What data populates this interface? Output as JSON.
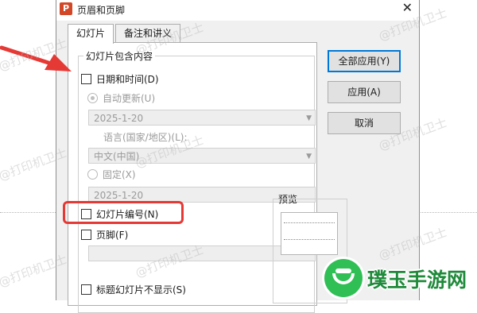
{
  "dialog": {
    "app_icon_letter": "P",
    "title": "页眉和页脚",
    "close_glyph": "✕",
    "tabs": [
      {
        "label": "幻灯片",
        "active": true
      },
      {
        "label": "备注和讲义",
        "active": false
      }
    ]
  },
  "slide_tab": {
    "group_title": "幻灯片包含内容",
    "date_time": {
      "label": "日期和时间(D)",
      "checked": false
    },
    "auto_update": {
      "label": "自动更新(U)",
      "selected": true,
      "enabled": false,
      "date_value": "2025-1-20"
    },
    "language": {
      "label": "语言(国家/地区)(L):",
      "value": "中文(中国)"
    },
    "fixed": {
      "label": "固定(X)",
      "selected": false,
      "enabled": false,
      "value": "2025-1-20"
    },
    "slide_number": {
      "label": "幻灯片编号(N)",
      "checked": false
    },
    "footer": {
      "label": "页脚(F)",
      "checked": false,
      "value": ""
    },
    "hide_on_title": {
      "label": "标题幻灯片不显示(S)",
      "checked": false
    }
  },
  "buttons": {
    "apply_all": "全部应用(Y)",
    "apply": "应用(A)",
    "cancel": "取消"
  },
  "preview": {
    "label": "预览"
  },
  "watermark_text": "@打印机卫士",
  "logo_text": "璞玉手游网",
  "colors": {
    "highlight": "#e53935",
    "arrow": "#e53935",
    "default_button_border": "#0078d7",
    "logo_green": "#2fbf55"
  }
}
